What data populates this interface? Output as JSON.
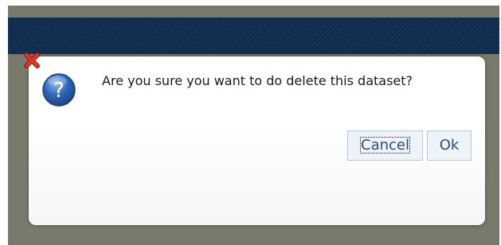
{
  "dialog": {
    "message": "Are you sure you want to do delete this dataset?",
    "buttons": {
      "cancel_label": "Cancel",
      "ok_label": "Ok"
    },
    "icons": {
      "close": "close-icon",
      "question": "question-icon"
    }
  },
  "colors": {
    "backdrop": "#7a7a6c",
    "header_bar": "#0d2849",
    "button_text": "#2b4e7a",
    "close_icon": "#d62b1f",
    "question_icon": "#2e66b8"
  }
}
